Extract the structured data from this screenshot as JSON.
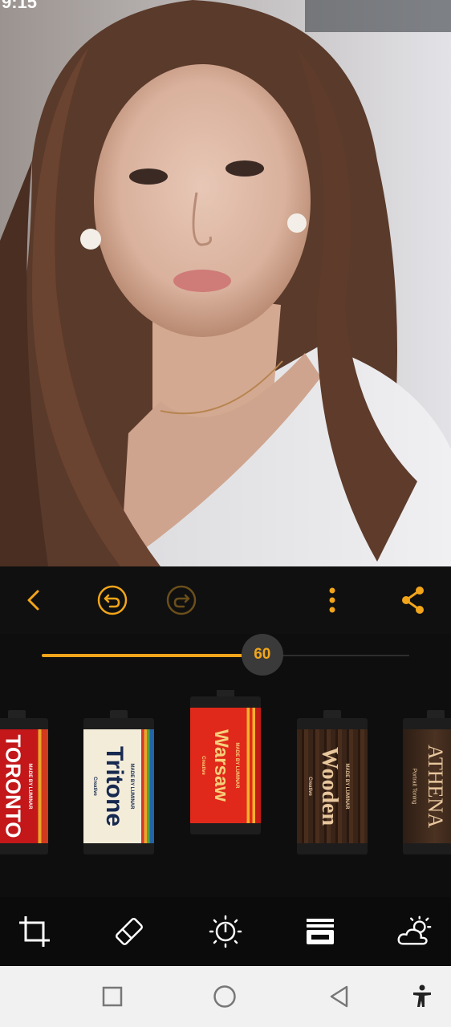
{
  "status": {
    "time": "9:15"
  },
  "photo": {
    "description_icon": "portrait-photo"
  },
  "toolbar": {
    "back_icon": "chevron-left-icon",
    "undo_icon": "undo-icon",
    "redo_icon": "redo-icon",
    "more_icon": "more-vertical-icon",
    "share_icon": "share-icon"
  },
  "slider": {
    "value": "60",
    "fraction": 0.6
  },
  "presets": [
    {
      "name": "TORONTO",
      "maker": "MADE BY LUMINAR",
      "sub": ""
    },
    {
      "name": "Tritone",
      "maker": "MADE BY LUMINAR",
      "sub": "Creative"
    },
    {
      "name": "Warsaw",
      "maker": "MADE BY LUMINAR",
      "sub": "Creative"
    },
    {
      "name": "Wooden",
      "maker": "MADE BY LUMINAR",
      "sub": "Creative"
    },
    {
      "name": "ATHENA",
      "maker": "",
      "sub": "Portrait Toning"
    }
  ],
  "tools": [
    "crop-icon",
    "eraser-icon",
    "brightness-icon",
    "filters-icon",
    "weather-icon"
  ],
  "nav": [
    "recents-square-icon",
    "home-circle-icon",
    "back-triangle-icon",
    "accessibility-icon"
  ],
  "colors": {
    "accent": "#f2a51a",
    "toolbar_bg": "#101010"
  }
}
